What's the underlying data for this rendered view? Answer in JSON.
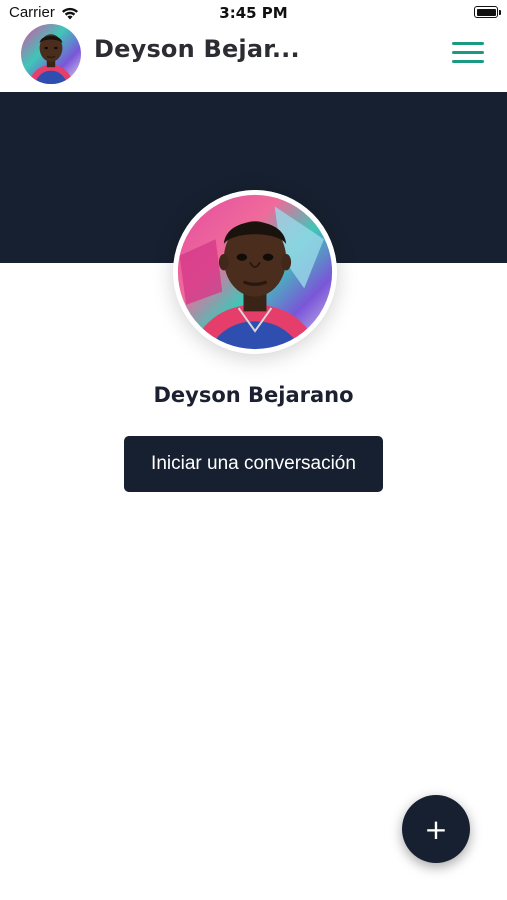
{
  "status_bar": {
    "carrier": "Carrier",
    "time": "3:45 PM",
    "wifi_icon": "wifi-icon",
    "battery_icon": "battery-icon"
  },
  "header": {
    "title": "Deyson Bejar...",
    "avatar_icon": "avatar",
    "menu_icon": "hamburger-menu-icon",
    "accent_color": "#1a9a82"
  },
  "banner": {
    "color": "#172030"
  },
  "profile": {
    "name": "Deyson Bejarano",
    "avatar_icon": "avatar"
  },
  "actions": {
    "start_conversation": "Iniciar una conversación",
    "fab_label": "+",
    "fab_icon": "plus-icon"
  }
}
